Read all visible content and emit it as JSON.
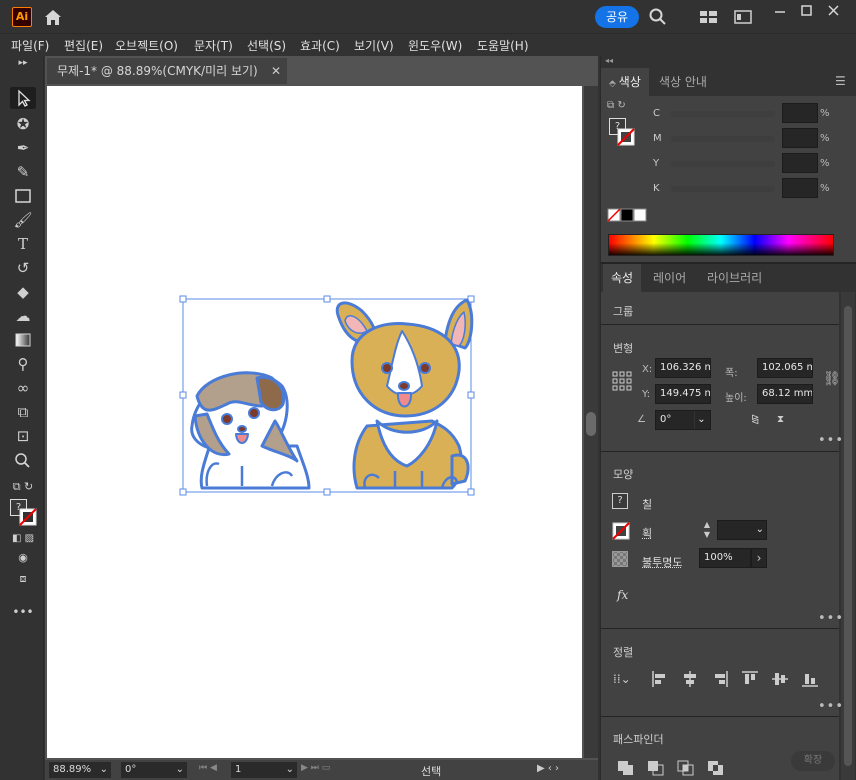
{
  "app": {
    "logo": "Ai",
    "share_label": "공유"
  },
  "menu": [
    "파일(F)",
    "편집(E)",
    "오브젝트(O)",
    "문자(T)",
    "선택(S)",
    "효과(C)",
    "보기(V)",
    "윈도우(W)",
    "도움말(H)"
  ],
  "document": {
    "tab_title": "무제-1* @ 88.89%(CMYK/미리 보기)"
  },
  "status": {
    "zoom": "88.89%",
    "rotation": "0°",
    "page": "1",
    "mode": "선택"
  },
  "color_panel": {
    "tabs": [
      "색상",
      "색상 안내"
    ],
    "channels": [
      {
        "label": "C",
        "unit": "%"
      },
      {
        "label": "M",
        "unit": "%"
      },
      {
        "label": "Y",
        "unit": "%"
      },
      {
        "label": "K",
        "unit": "%"
      }
    ],
    "fill_placeholder": "?"
  },
  "props_panel": {
    "tabs": [
      "속성",
      "레이어",
      "라이브러리"
    ],
    "group_label": "그룹",
    "transform_label": "변형",
    "x_label": "X:",
    "x_value": "106.326 m",
    "y_label": "Y:",
    "y_value": "149.475 m",
    "w_label": "폭:",
    "w_value": "102.065 m",
    "h_label": "높이:",
    "h_value": "68.12 mm",
    "angle_value": "0°",
    "appearance_label": "모양",
    "fill_label": "칠",
    "stroke_label": "획",
    "opacity_label": "불투명도",
    "opacity_value": "100%",
    "fx_label": "fx",
    "align_label": "정렬",
    "pathfinder_label": "패스파인더",
    "expand_label": "확장"
  },
  "colors": {
    "accent": "#1473e6",
    "selection": "#4a7bd6",
    "corgi_tan": "#d9b056",
    "dog_brown": "#8f6a4a",
    "tongue": "#f08b8b"
  }
}
